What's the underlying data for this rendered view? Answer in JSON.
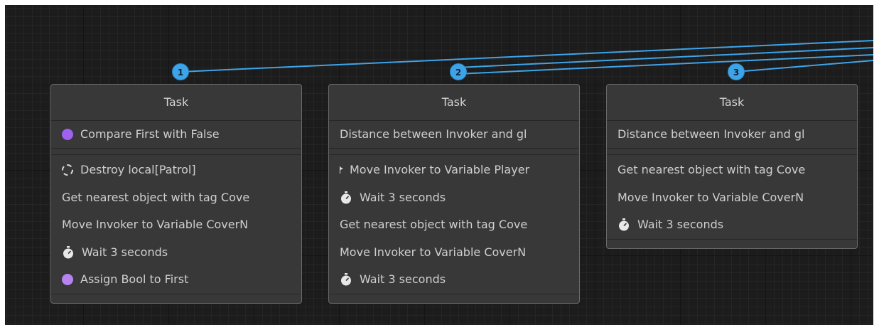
{
  "nodes": [
    {
      "port": "1",
      "title": "Task",
      "condition": {
        "icon": "purple-dot-icon",
        "text": "Compare First with False"
      },
      "actions": [
        {
          "icon": "dashed-circle-icon",
          "text": "Destroy local[Patrol]"
        },
        {
          "icon": "",
          "text": "Get nearest object with tag Cove"
        },
        {
          "icon": "",
          "text": "Move Invoker to Variable CoverN"
        },
        {
          "icon": "stopwatch-icon",
          "text": "Wait 3 seconds"
        },
        {
          "icon": "purple-dot-icon",
          "text": "Assign Bool to First"
        }
      ]
    },
    {
      "port": "2",
      "title": "Task",
      "condition": {
        "icon": "",
        "text": "Distance between Invoker and gl"
      },
      "actions": [
        {
          "icon": "flag-icon",
          "text": "Move Invoker to Variable Player"
        },
        {
          "icon": "stopwatch-icon",
          "text": "Wait 3 seconds"
        },
        {
          "icon": "",
          "text": "Get nearest object with tag Cove"
        },
        {
          "icon": "",
          "text": "Move Invoker to Variable CoverN"
        },
        {
          "icon": "stopwatch-icon",
          "text": "Wait 3 seconds"
        }
      ]
    },
    {
      "port": "3",
      "title": "Task",
      "condition": {
        "icon": "",
        "text": "Distance between Invoker and gl"
      },
      "actions": [
        {
          "icon": "",
          "text": "Get nearest object with tag Cove"
        },
        {
          "icon": "",
          "text": "Move Invoker to Variable CoverN"
        },
        {
          "icon": "stopwatch-icon",
          "text": "Wait 3 seconds"
        }
      ]
    }
  ],
  "colors": {
    "connection": "#3ea4e8",
    "canvas": "#1c1c1c",
    "node_bg": "#383838"
  }
}
